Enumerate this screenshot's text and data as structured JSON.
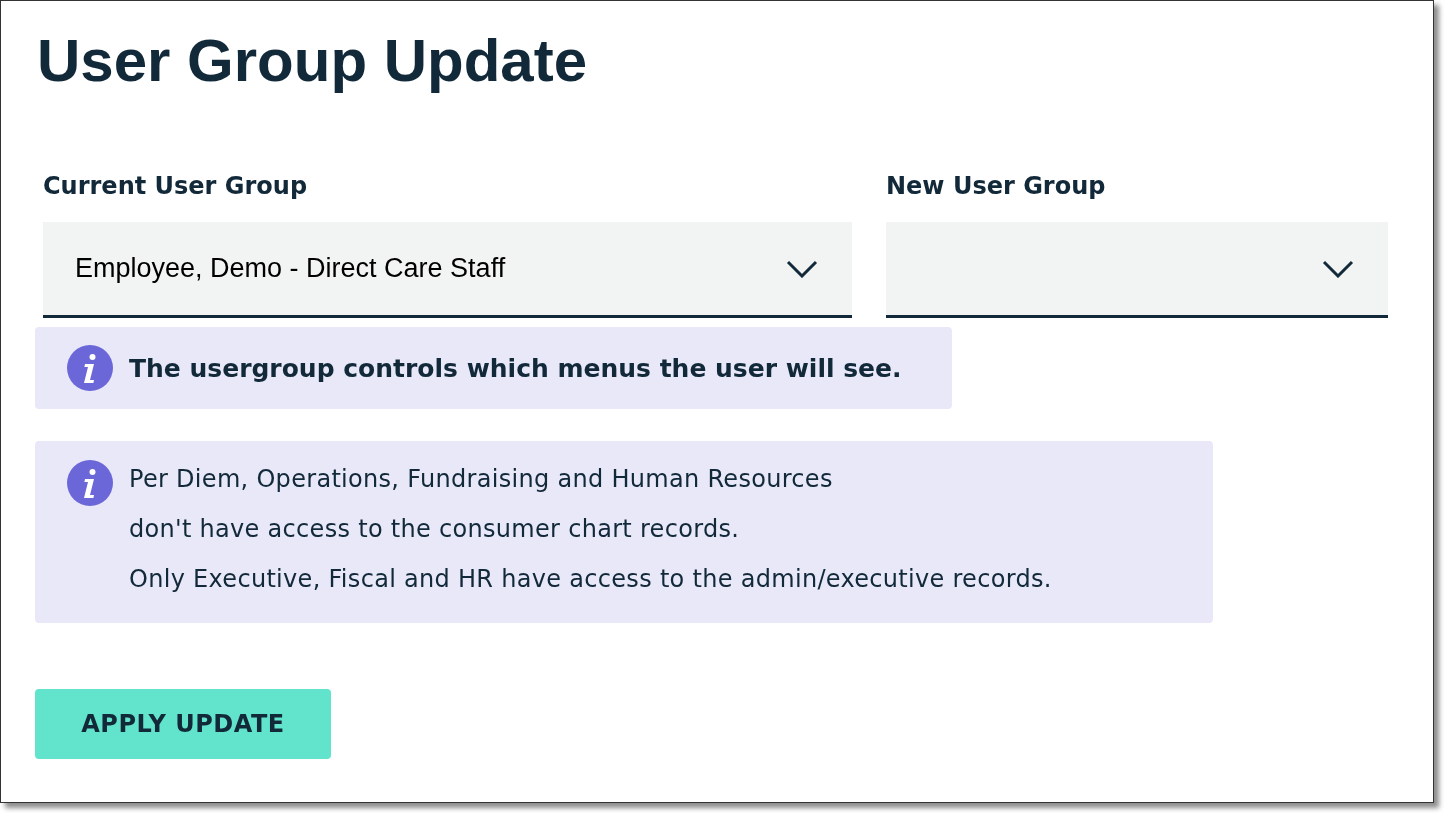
{
  "title": "User Group Update",
  "fields": [
    {
      "label": "Current User Group",
      "value": "Employee, Demo - Direct Care Staff"
    },
    {
      "label": "New User Group"
    }
  ],
  "notices": [
    {
      "kind": "bold",
      "lines": [
        "The usergroup controls which menus the user will see."
      ]
    },
    {
      "kind": "plain",
      "lines": [
        "Per Diem, Operations, Fundraising and Human Resources",
        "don't have access to the consumer chart records.",
        "Only Executive, Fiscal and HR have access to the admin/executive records."
      ]
    }
  ],
  "button": "APPLY UPDATE"
}
